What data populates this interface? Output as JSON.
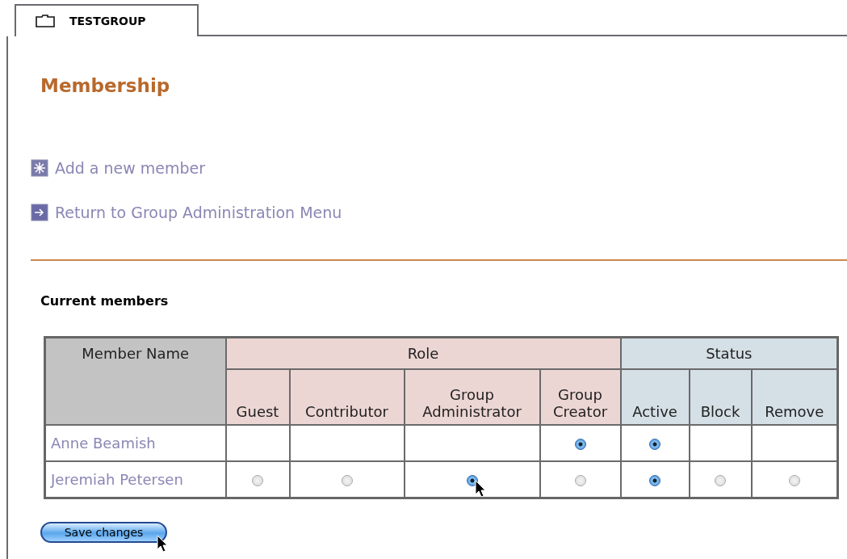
{
  "tab": {
    "label": "TESTGROUP",
    "selected": true
  },
  "heading": "Membership",
  "links": [
    {
      "kind": "add",
      "label": "Add a new member"
    },
    {
      "kind": "return",
      "label": "Return to Group Administration Menu"
    }
  ],
  "section_title": "Current members",
  "table": {
    "name_header": "Member Name",
    "groups": [
      {
        "kind": "role",
        "label": "Role",
        "columns": [
          "Guest",
          "Contributor",
          "Group Administrator",
          "Group Creator"
        ]
      },
      {
        "kind": "status",
        "label": "Status",
        "columns": [
          "Active",
          "Block",
          "Remove"
        ]
      }
    ],
    "rows": [
      {
        "name": "Anne Beamish",
        "cells": [
          {
            "kind": "empty"
          },
          {
            "kind": "empty"
          },
          {
            "kind": "empty"
          },
          {
            "kind": "radio",
            "selected": true
          },
          {
            "kind": "radio",
            "selected": true
          },
          {
            "kind": "empty"
          },
          {
            "kind": "empty"
          }
        ]
      },
      {
        "name": "Jeremiah Petersen",
        "cells": [
          {
            "kind": "radio",
            "selected": false
          },
          {
            "kind": "radio",
            "selected": false
          },
          {
            "kind": "radio",
            "selected": true
          },
          {
            "kind": "radio",
            "selected": false
          },
          {
            "kind": "radio",
            "selected": true
          },
          {
            "kind": "radio",
            "selected": false
          },
          {
            "kind": "radio",
            "selected": false
          }
        ]
      }
    ]
  },
  "save_button": "Save changes"
}
